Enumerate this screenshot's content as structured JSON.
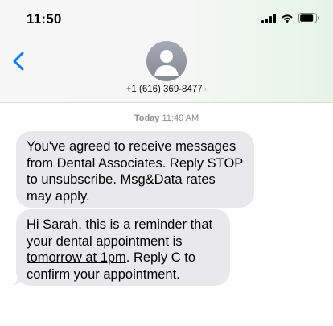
{
  "status_bar": {
    "time": "11:50"
  },
  "header": {
    "contact_number": "+1 (616) 369-8477",
    "contact_chevron": "›"
  },
  "timestamp": {
    "day": "Today",
    "time": "11:49 AM"
  },
  "messages": [
    {
      "text": "You've agreed to receive messages from Dental Associates. Reply STOP to unsubscribe. Msg&Data rates may apply."
    },
    {
      "text_before": "Hi Sarah, this is a reminder that your dental appointment is ",
      "link_text": "tomorrow at 1pm",
      "text_after": ". Reply C to confirm your appointment."
    }
  ],
  "icons": [
    "signal-icon",
    "wifi-icon",
    "battery-icon",
    "back-chevron-icon",
    "person-icon"
  ],
  "colors": {
    "accent": "#0a7aff",
    "bubble": "#e9e9eb",
    "timestamp": "#8e8e93"
  }
}
